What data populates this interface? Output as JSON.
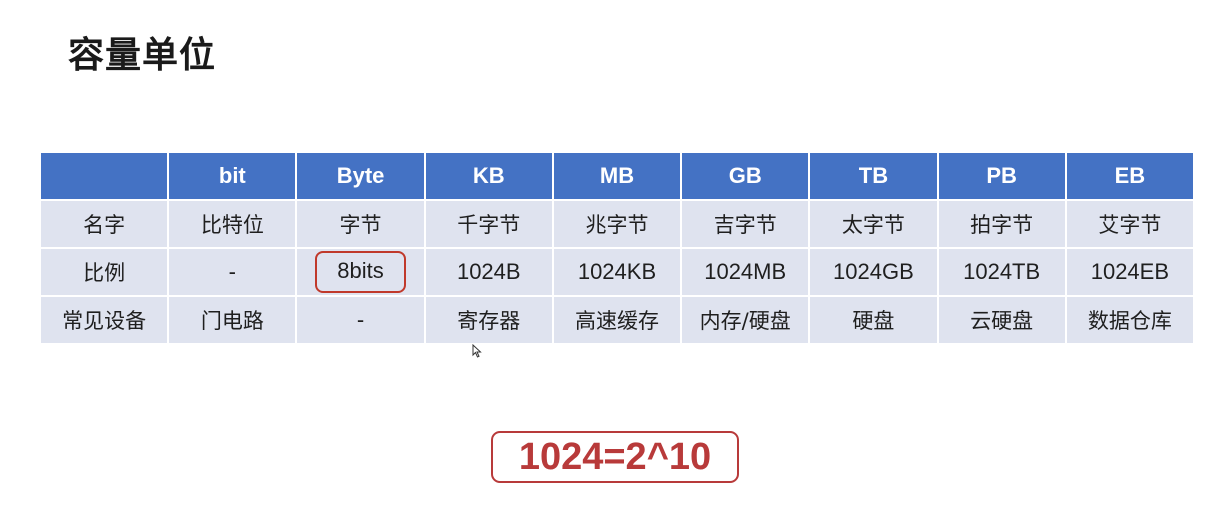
{
  "title": "容量单位",
  "table": {
    "headers": [
      "",
      "bit",
      "Byte",
      "KB",
      "MB",
      "GB",
      "TB",
      "PB",
      "EB"
    ],
    "rows": [
      [
        "名字",
        "比特位",
        "字节",
        "千字节",
        "兆字节",
        "吉字节",
        "太字节",
        "拍字节",
        "艾字节"
      ],
      [
        "比例",
        "-",
        "8bits",
        "1024B",
        "1024KB",
        "1024MB",
        "1024GB",
        "1024TB",
        "1024EB"
      ],
      [
        "常见设备",
        "门电路",
        "-",
        "寄存器",
        "高速缓存",
        "内存/硬盘",
        "硬盘",
        "云硬盘",
        "数据仓库"
      ]
    ]
  },
  "formula": "1024=2^10",
  "colors": {
    "header_bg": "#4472c4",
    "cell_bg": "#dfe3ef",
    "highlight": "#b83a3a"
  },
  "icons": {
    "cursor": "mouse-pointer-icon"
  }
}
